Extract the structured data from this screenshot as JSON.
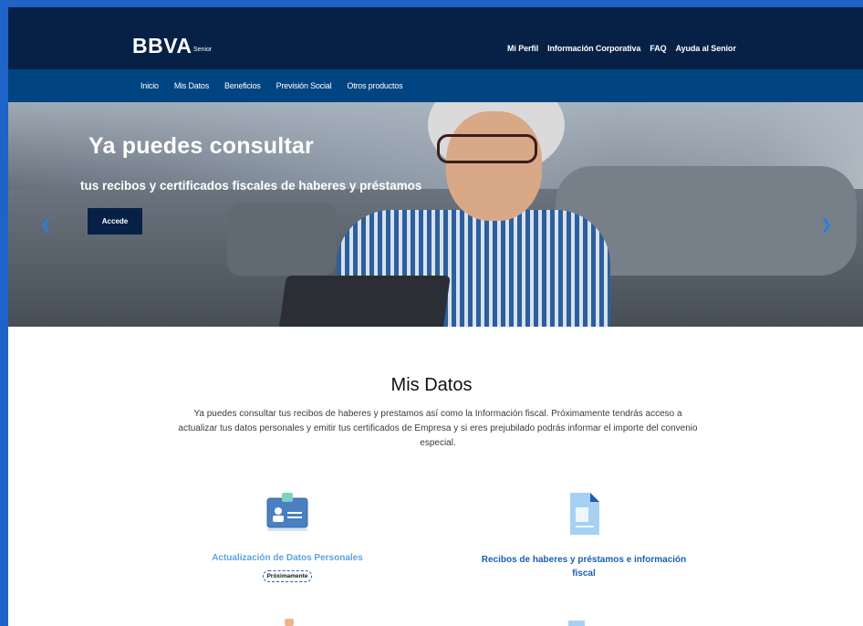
{
  "brand": {
    "logo": "BBVA",
    "sub": "Senior"
  },
  "top_nav": [
    "Mi Perfil",
    "Información Corporativa",
    "FAQ",
    "Ayuda al Senior"
  ],
  "sub_nav": [
    "Inicio",
    "Mis Datos",
    "Beneficios",
    "Previsión Social",
    "Otros productos"
  ],
  "hero": {
    "title": "Ya puedes consultar",
    "subtitle": "tus recibos y certificados fiscales de haberes y préstamos",
    "button": "Accede"
  },
  "section": {
    "title": "Mis Datos",
    "text": "Ya puedes consultar tus recibos de haberes y prestamos así como la Información fiscal. Próximamente tendrás acceso a actualizar tus datos personales y emitir tus certificados de Empresa y si eres prejubilado podrás informar el importe del convenio especial."
  },
  "cards": [
    {
      "title": "Actualización de Datos Personales",
      "badge": "Próximamente",
      "icon": "id-card-icon"
    },
    {
      "title": "Recibos de haberes y préstamos e información fiscal",
      "icon": "document-icon"
    }
  ],
  "colors": {
    "navy": "#072146",
    "blue": "#004481",
    "accent": "#1e63c7",
    "light_blue": "#5fa3e0"
  }
}
